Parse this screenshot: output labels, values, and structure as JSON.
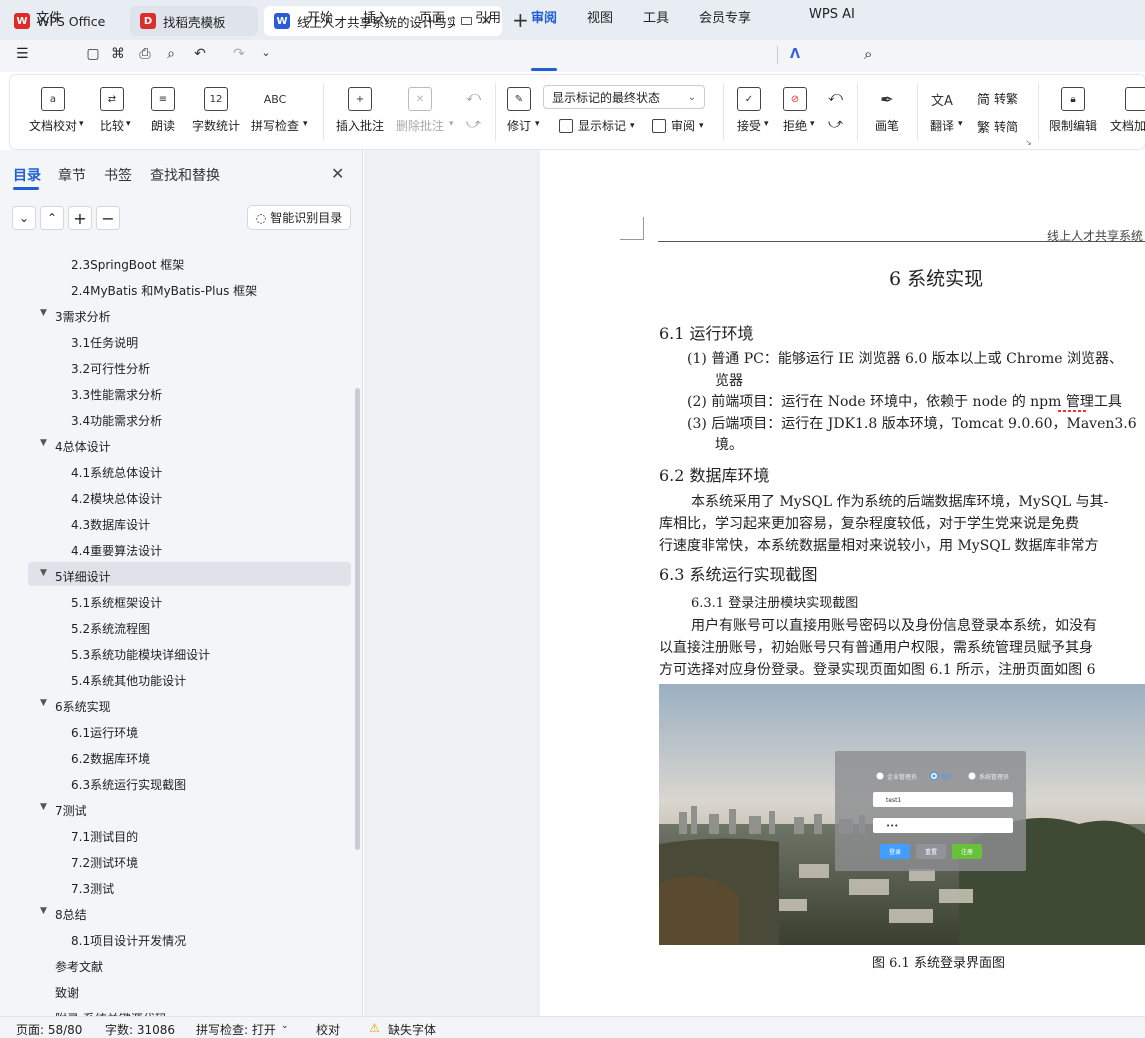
{
  "tabs": [
    {
      "label": "WPS Office",
      "icon": "wps-logo-icon"
    },
    {
      "label": "找稻壳模板",
      "icon": "docer-icon"
    },
    {
      "label": "线上人才共享系统的设计与实现",
      "icon": "word-doc-icon"
    }
  ],
  "menu": {
    "file": "文件",
    "items": [
      "开始",
      "插入",
      "页面",
      "引用",
      "审阅",
      "视图",
      "工具",
      "会员专享"
    ],
    "active": "审阅",
    "wps_ai": "WPS AI"
  },
  "ribbon": {
    "doc_proof": "文档校对",
    "compare": "比较",
    "read_aloud": "朗读",
    "word_count": "字数统计",
    "spell_check": "拼写检查",
    "insert_comment": "插入批注",
    "delete_comment": "删除批注",
    "revise": "修订",
    "markup_select": "显示标记的最终状态",
    "show_markup": "显示标记",
    "review": "审阅",
    "accept": "接受",
    "reject": "拒绝",
    "pen": "画笔",
    "translate": "翻译",
    "to_trad": "转繁",
    "to_simp": "转简",
    "restrict_edit": "限制编辑",
    "doc_encrypt": "文档加"
  },
  "nav": {
    "tabs": [
      "目录",
      "章节",
      "书签",
      "查找和替换"
    ],
    "smart_toc": "智能识别目录",
    "toc": [
      {
        "text": "2.3SpringBoot 框架",
        "level": 2
      },
      {
        "text": "2.4MyBatis 和MyBatis-Plus 框架",
        "level": 2
      },
      {
        "text": "3需求分析",
        "level": 1
      },
      {
        "text": "3.1任务说明",
        "level": 2
      },
      {
        "text": "3.2可行性分析",
        "level": 2
      },
      {
        "text": "3.3性能需求分析",
        "level": 2
      },
      {
        "text": "3.4功能需求分析",
        "level": 2
      },
      {
        "text": "4总体设计",
        "level": 1
      },
      {
        "text": "4.1系统总体设计",
        "level": 2
      },
      {
        "text": "4.2模块总体设计",
        "level": 2
      },
      {
        "text": "4.3数据库设计",
        "level": 2
      },
      {
        "text": "4.4重要算法设计",
        "level": 2
      },
      {
        "text": "5详细设计",
        "level": 1
      },
      {
        "text": "5.1系统框架设计",
        "level": 2
      },
      {
        "text": "5.2系统流程图",
        "level": 2
      },
      {
        "text": "5.3系统功能模块详细设计",
        "level": 2
      },
      {
        "text": "5.4系统其他功能设计",
        "level": 2
      },
      {
        "text": "6系统实现",
        "level": 1
      },
      {
        "text": "6.1运行环境",
        "level": 2
      },
      {
        "text": "6.2数据库环境",
        "level": 2
      },
      {
        "text": "6.3系统运行实现截图",
        "level": 2
      },
      {
        "text": "7测试",
        "level": 1
      },
      {
        "text": "7.1测试目的",
        "level": 2
      },
      {
        "text": "7.2测试环境",
        "level": 2
      },
      {
        "text": "7.3测试",
        "level": 2
      },
      {
        "text": "8总结",
        "level": 1
      },
      {
        "text": "8.1项目设计开发情况",
        "level": 2
      },
      {
        "text": "参考文献",
        "level": 0
      },
      {
        "text": "致谢",
        "level": 0
      },
      {
        "text": "附录 系统关键源代码",
        "level": 0
      }
    ]
  },
  "doc": {
    "header": "线上人才共享系统",
    "chapter": "6   系统实现",
    "s61": "6.1  运行环境",
    "item1a": "(1)  普通 PC：能够运行 IE 浏览器 6.0 版本以上或 Chrome 浏览器、",
    "item1b": "览器",
    "item2": "(2)  前端项目：运行在 Node 环境中，依赖于 node 的 npm 管理工具",
    "item3a": "(3)  后端项目：运行在 JDK1.8 版本环境，Tomcat 9.0.60，Maven3.6",
    "item3b": "境。",
    "s62": "6.2  数据库环境",
    "p62a": "本系统采用了 MySQL 作为系统的后端数据库环境，MySQL 与其-",
    "p62b": "库相比，学习起来更加容易，复杂程度较低，对于学生党来说是免费",
    "p62c": "行速度非常快，本系统数据量相对来说较小，用 MySQL 数据库非常方",
    "s63": "6.3  系统运行实现截图",
    "s631": "6.3.1  登录注册模块实现截图",
    "p631a": "用户有账号可以直接用账号密码以及身份信息登录本系统，如没有",
    "p631b": "以直接注册账号，初始账号只有普通用户权限，需系统管理员赋予其身",
    "p631c": "方可选择对应身份登录。登录实现页面如图 6.1 所示，注册页面如图 6",
    "caption": "图 6.1  系统登录界面图",
    "login": {
      "radio1": "企业管理员",
      "radio2": "用户",
      "radio3": "系统管理员",
      "username": "test1",
      "password": "•••",
      "btn_login": "登录",
      "btn_reset": "重置",
      "btn_register": "注册"
    }
  },
  "status": {
    "page": "页面: 58/80",
    "words": "字数: 31086",
    "spell": "拼写检查: 打开",
    "proof": "校对",
    "missing_font": "缺失字体"
  },
  "colors": {
    "accent": "#1f5fd6",
    "wps_red": "#e02a2a",
    "docer_red": "#d9302e",
    "word_blue": "#2b5cd8"
  }
}
